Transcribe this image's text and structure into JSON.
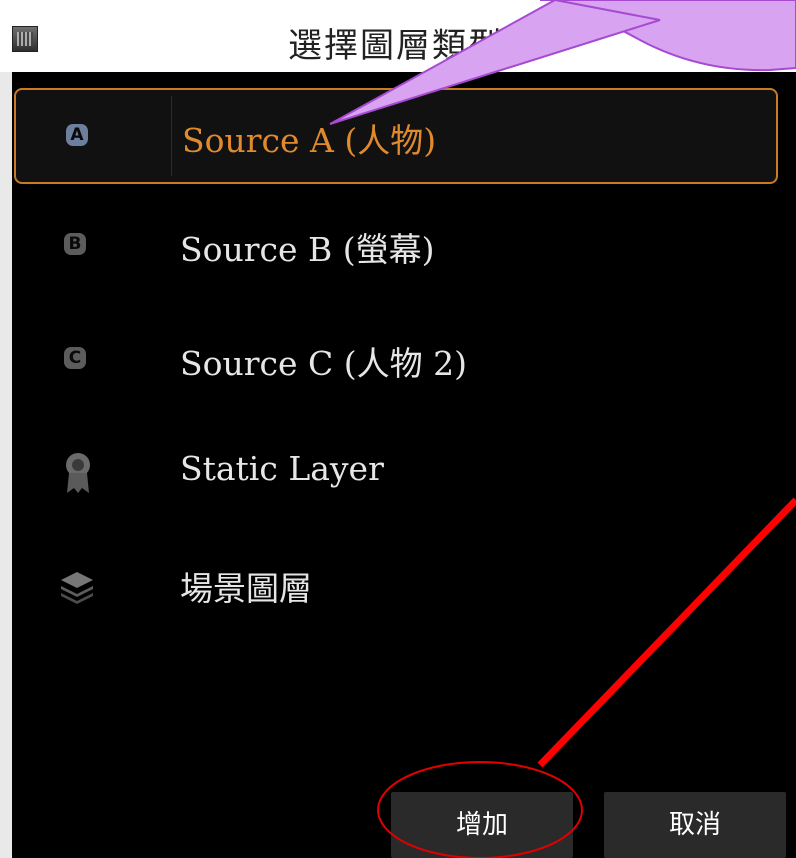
{
  "window": {
    "title": "選擇圖層類型",
    "icon": "app-icon"
  },
  "layer_types": [
    {
      "id": "source-a",
      "icon": "badge-a-icon",
      "badge_letter": "A",
      "label": "Source A (人物)",
      "selected": true
    },
    {
      "id": "source-b",
      "icon": "badge-b-icon",
      "badge_letter": "B",
      "label": "Source B (螢幕)",
      "selected": false
    },
    {
      "id": "source-c",
      "icon": "badge-c-icon",
      "badge_letter": "C",
      "label": "Source C (人物 2)",
      "selected": false
    },
    {
      "id": "static-layer",
      "icon": "ribbon-icon",
      "label": "Static Layer",
      "selected": false
    },
    {
      "id": "scene-layer",
      "icon": "layers-icon",
      "label": "場景圖層",
      "selected": false
    }
  ],
  "buttons": {
    "add": "增加",
    "cancel": "取消"
  },
  "colors": {
    "dialog_bg": "#000000",
    "selected_accent": "#e08a2d",
    "annotation_arrow": "#ff0000",
    "callout_fill": "#d8a3f0"
  }
}
